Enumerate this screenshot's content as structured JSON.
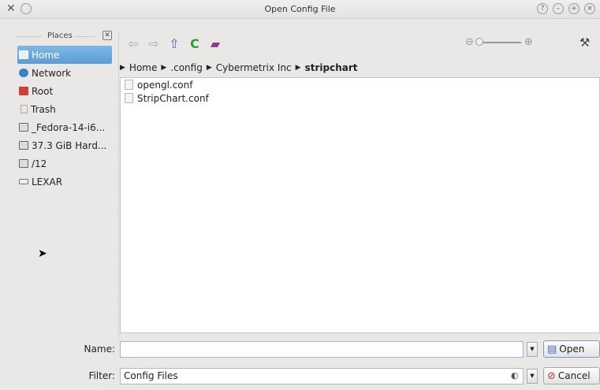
{
  "window": {
    "title": "Open Config File"
  },
  "places": {
    "header": "Places",
    "items": [
      {
        "label": "Home",
        "icon": "home-folder-icon",
        "color": "#7fb8e6"
      },
      {
        "label": "Network",
        "icon": "network-globe-icon",
        "color": "#3d7fc4"
      },
      {
        "label": "Root",
        "icon": "root-folder-icon",
        "color": "#d63b3b"
      },
      {
        "label": "Trash",
        "icon": "trash-icon",
        "color": "#aaaaaa"
      },
      {
        "label": "_Fedora-14-i6...",
        "icon": "drive-icon",
        "color": "#888888"
      },
      {
        "label": "37.3 GiB Hard...",
        "icon": "hard-drive-icon",
        "color": "#888888"
      },
      {
        "label": "/12",
        "icon": "drive-icon",
        "color": "#888888"
      },
      {
        "label": "LEXAR",
        "icon": "usb-drive-icon",
        "color": "#888888"
      }
    ]
  },
  "breadcrumb": {
    "items": [
      "Home",
      ".config",
      "Cybermetrix Inc"
    ],
    "current": "stripchart"
  },
  "files": [
    {
      "name": "opengl.conf"
    },
    {
      "name": "StripChart.conf"
    }
  ],
  "name_field": {
    "label": "Name:",
    "value": ""
  },
  "filter_field": {
    "label": "Filter:",
    "value": "Config Files"
  },
  "buttons": {
    "open": "Open",
    "cancel": "Cancel"
  },
  "colors": {
    "accent": "#5b9cd6",
    "reload": "#2e9d2e",
    "cancel": "#d22e2e"
  }
}
